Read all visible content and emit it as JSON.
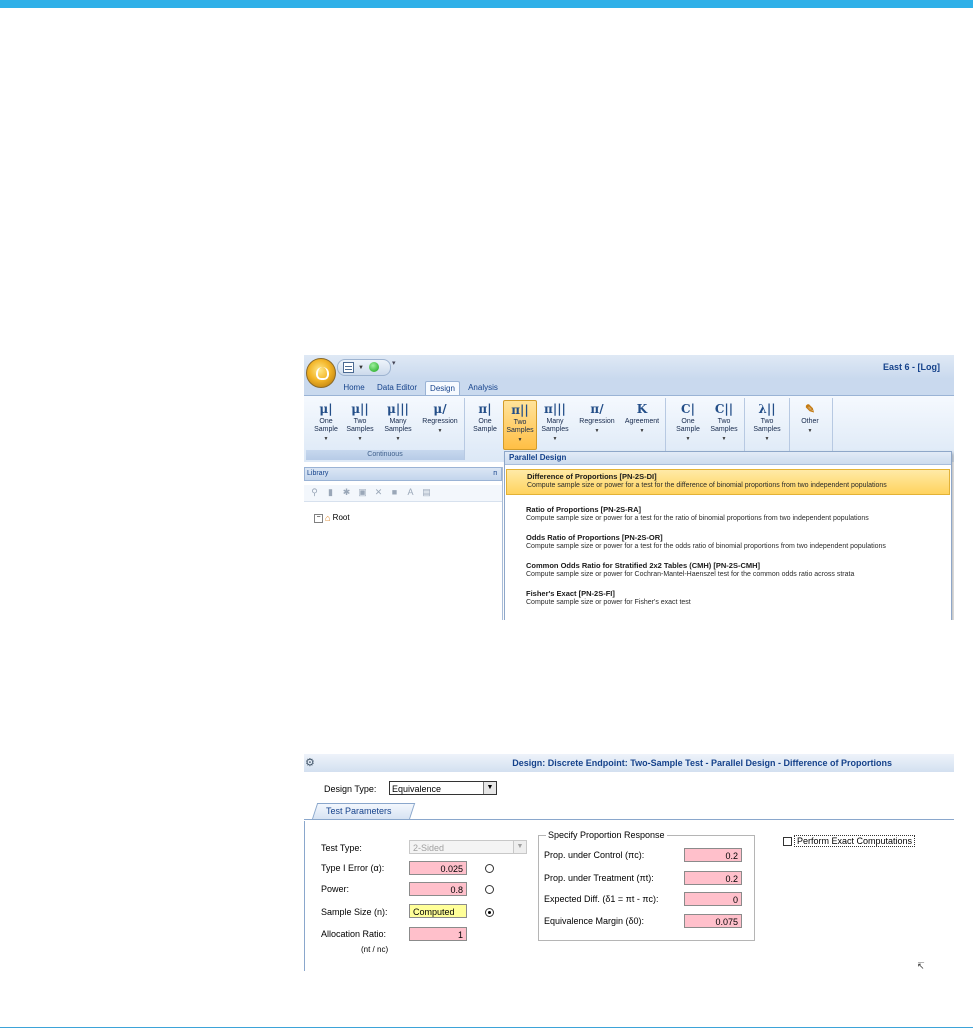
{
  "ribbon_window": {
    "title": "East 6 - [Log]",
    "tabs": [
      "Home",
      "Data Editor",
      "Design",
      "Analysis"
    ],
    "active_tab": "Design",
    "groups": [
      {
        "label": "Continuous",
        "buttons": [
          {
            "icon": "μ|",
            "label": "One\nSample"
          },
          {
            "icon": "μ||",
            "label": "Two\nSamples"
          },
          {
            "icon": "μ|||",
            "label": "Many\nSamples"
          },
          {
            "icon": "μ/",
            "label": "Regression"
          }
        ]
      },
      {
        "label": "",
        "buttons": [
          {
            "icon": "π|",
            "label": "One\nSample"
          },
          {
            "icon": "π||",
            "label": "Two\nSamples"
          },
          {
            "icon": "π|||",
            "label": "Many\nSamples"
          },
          {
            "icon": "π/",
            "label": "Regression"
          },
          {
            "icon": "K",
            "label": "Agreement"
          }
        ]
      },
      {
        "label": "",
        "buttons": [
          {
            "icon": "C|",
            "label": "One\nSample"
          },
          {
            "icon": "C||",
            "label": "Two\nSamples"
          }
        ]
      },
      {
        "label": "",
        "buttons": [
          {
            "icon": "λ||",
            "label": "Two\nSamples"
          }
        ]
      },
      {
        "label": "",
        "buttons": [
          {
            "icon": "✎",
            "label": "Other"
          }
        ]
      }
    ],
    "library": {
      "header": "Library",
      "root": "Root"
    },
    "dropdown": {
      "header": "Parallel Design",
      "items": [
        {
          "title": "Difference of Proportions [PN-2S-DI]",
          "desc": "Compute sample size or power for a test for the difference of binomial proportions from two independent populations"
        },
        {
          "title": "Ratio of Proportions [PN-2S-RA]",
          "desc": "Compute sample size or power for a test for the ratio of binomial proportions from two independent populations"
        },
        {
          "title": "Odds Ratio of Proportions [PN-2S-OR]",
          "desc": "Compute sample size or power for a test for the odds ratio of binomial proportions from two independent populations"
        },
        {
          "title": "Common Odds Ratio for Stratified 2x2 Tables (CMH) [PN-2S-CMH]",
          "desc": "Compute sample size or power for Cochran-Mantel-Haenszel test for the common odds ratio across strata"
        },
        {
          "title": "Fisher's Exact [PN-2S-FI]",
          "desc": "Compute sample size or power for Fisher's exact test"
        }
      ]
    }
  },
  "design_dialog": {
    "title": "Design: Discrete Endpoint: Two-Sample Test - Parallel Design - Difference of Proportions",
    "design_type_label": "Design Type:",
    "design_type_value": "Equivalence",
    "tab": "Test Parameters",
    "left": {
      "test_type_label": "Test Type:",
      "test_type_value": "2-Sided",
      "type1_label": "Type I Error (α):",
      "type1_value": "0.025",
      "power_label": "Power:",
      "power_value": "0.8",
      "sample_size_label": "Sample Size (n):",
      "sample_size_value": "Computed",
      "allocation_label": "Allocation Ratio:",
      "allocation_sub": "(nt / nc)",
      "allocation_value": "1"
    },
    "proportion": {
      "legend": "Specify Proportion Response",
      "control_label": "Prop. under Control (πc):",
      "control_value": "0.2",
      "treatment_label": "Prop. under Treatment (πt):",
      "treatment_value": "0.2",
      "diff_label": "Expected Diff. (δ1 = πt - πc):",
      "diff_value": "0",
      "margin_label": "Equivalence Margin (δ0):",
      "margin_value": "0.075"
    },
    "exact_label": "Perform Exact Computations"
  }
}
